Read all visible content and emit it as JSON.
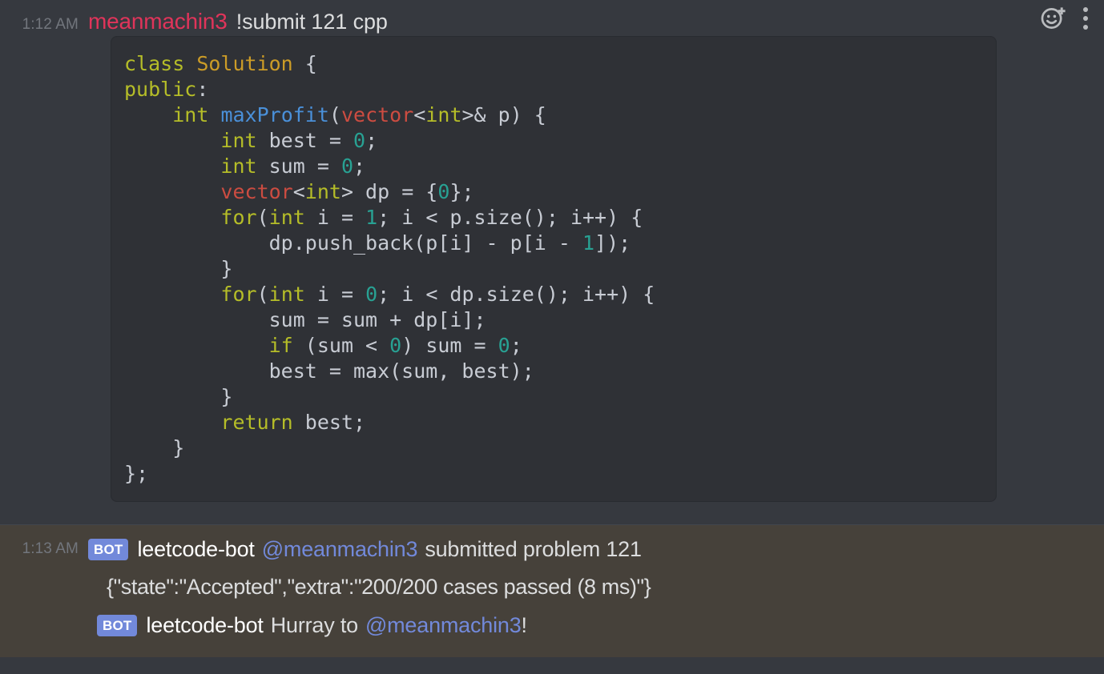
{
  "messages": [
    {
      "timestamp": "1:12 AM",
      "author": "meanmachin3",
      "author_color": "#e0345a",
      "content": "!submit 121 cpp",
      "code": {
        "language": "cpp",
        "lines": [
          "class Solution {",
          "public:",
          "    int maxProfit(vector<int>& p) {",
          "        int best = 0;",
          "        int sum = 0;",
          "        vector<int> dp = {0};",
          "        for(int i = 1; i < p.size(); i++) {",
          "            dp.push_back(p[i] - p[i - 1]);",
          "        }",
          "        for(int i = 0; i < dp.size(); i++) {",
          "            sum = sum + dp[i];",
          "            if (sum < 0) sum = 0;",
          "            best = max(sum, best);",
          "        }",
          "        return best;",
          "    }",
          "};"
        ]
      }
    },
    {
      "timestamp": "1:13 AM",
      "bot_badge": "BOT",
      "author": "leetcode-bot",
      "mention": "@meanmachin3",
      "content_after_mention": "submitted problem 121",
      "result_json": "{\"state\":\"Accepted\",\"extra\":\"200/200 cases passed (8 ms)\"}"
    },
    {
      "bot_badge": "BOT",
      "author": "leetcode-bot",
      "text_before_mention": "Hurray to",
      "mention": "@meanmachin3",
      "text_after_mention": "!"
    }
  ],
  "header_actions": {
    "add_reaction": "add-reaction",
    "more": "more-options"
  },
  "colors": {
    "app_bg": "#36393f",
    "code_bg": "#2f3136",
    "mention_highlight_bg": "#46413a",
    "bot_badge": "#7289da",
    "mention_text": "#7289da",
    "username": "#e0345a",
    "timestamp": "#72767d",
    "body_text": "#dcddde"
  }
}
